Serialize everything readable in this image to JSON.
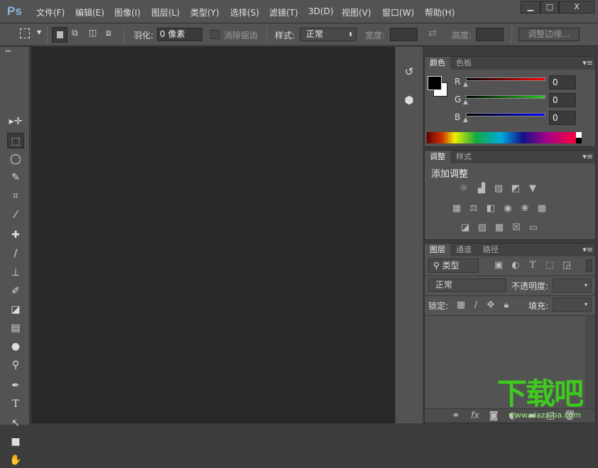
{
  "app": {
    "logo": "Ps"
  },
  "menu": [
    "文件(F)",
    "编辑(E)",
    "图像(I)",
    "图层(L)",
    "类型(Y)",
    "选择(S)",
    "滤镜(T)",
    "3D(D)",
    "视图(V)",
    "窗口(W)",
    "帮助(H)"
  ],
  "window_controls": {
    "minimize": "▁",
    "maximize": "□",
    "close": "X"
  },
  "options": {
    "feather_label": "羽化:",
    "feather_value": "0 像素",
    "antialias_label": "消除锯齿",
    "style_label": "样式:",
    "style_value": "正常",
    "width_label": "宽度:",
    "height_label": "高度:",
    "refine_edge": "调整边缘..."
  },
  "tools": [
    "move-tool",
    "marquee-tool",
    "lasso-tool",
    "quick-selection-tool",
    "crop-tool",
    "eyedropper-tool",
    "healing-brush-tool",
    "brush-tool",
    "clone-stamp-tool",
    "history-brush-tool",
    "eraser-tool",
    "gradient-tool",
    "blur-tool",
    "dodge-tool",
    "pen-tool",
    "type-tool",
    "path-selection-tool",
    "rectangle-tool",
    "hand-tool"
  ],
  "color_panel": {
    "tabs": [
      "颜色",
      "色板"
    ],
    "r_label": "R",
    "g_label": "G",
    "b_label": "B",
    "r": "0",
    "g": "0",
    "b": "0",
    "fg": "#000000",
    "bg": "#ffffff"
  },
  "adjust_panel": {
    "tabs": [
      "调整",
      "样式"
    ],
    "title": "添加调整"
  },
  "layers_panel": {
    "tabs": [
      "图层",
      "通道",
      "路径"
    ],
    "filter_value": "类型",
    "blend_mode": "正常",
    "opacity_label": "不透明度:",
    "lock_label": "锁定:",
    "fill_label": "填充:"
  },
  "watermark": {
    "text": "下载吧",
    "url": "www.xiazaiba.com"
  }
}
